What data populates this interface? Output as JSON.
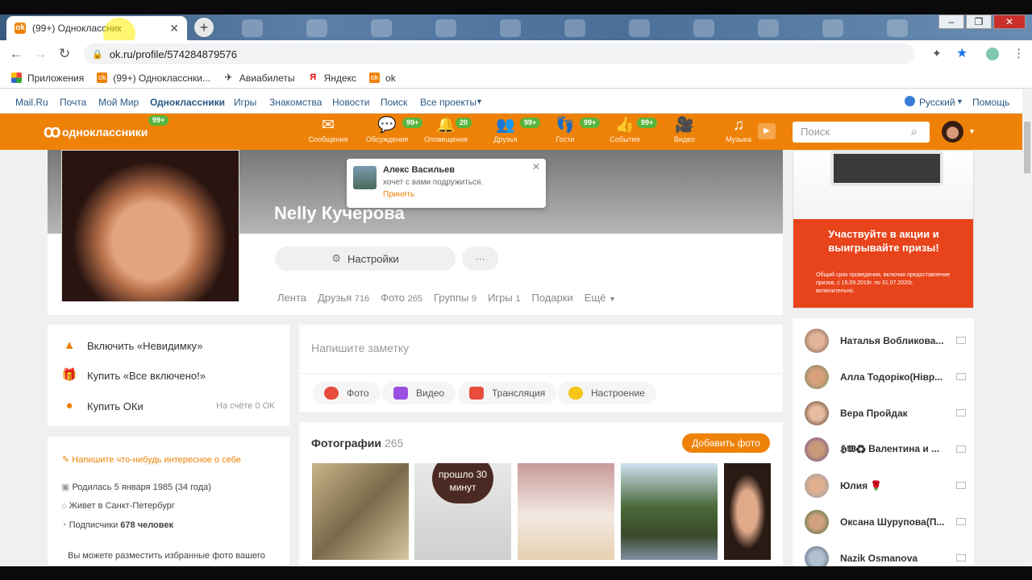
{
  "browser": {
    "tab_title": "(99+) Одноклассник",
    "tab_favicon": "ok",
    "url": "ok.ru/profile/574284879576",
    "bookmarks": [
      "Приложения",
      "(99+) Однокласснки...",
      "Авиабилеты",
      "Яндекс",
      "ok"
    ]
  },
  "portal": {
    "links": [
      "Mail.Ru",
      "Почта",
      "Мой Мир",
      "Одноклассники",
      "Игры",
      "Знакомства",
      "Новости",
      "Поиск",
      "Все проекты"
    ],
    "language": "Русский",
    "help": "Помощь"
  },
  "okbar": {
    "logo": "одноклассники",
    "logo_badge": "99+",
    "nav": [
      {
        "label": "Сообщения",
        "badge": ""
      },
      {
        "label": "Обсуждения",
        "badge": "99+"
      },
      {
        "label": "Оповещения",
        "badge": "20"
      },
      {
        "label": "Друзья",
        "badge": "99+"
      },
      {
        "label": "Гости",
        "badge": "99+"
      },
      {
        "label": "События",
        "badge": "99+"
      },
      {
        "label": "Видео",
        "badge": ""
      },
      {
        "label": "Музыка",
        "badge": ""
      }
    ],
    "search_placeholder": "Поиск",
    "accent": "#ee8208",
    "badge_color": "#58b53b"
  },
  "profile": {
    "name": "Nelly Кучерова",
    "settings": "Настройки",
    "more": "···",
    "tabs": [
      {
        "label": "Лента",
        "count": ""
      },
      {
        "label": "Друзья",
        "count": "716"
      },
      {
        "label": "Фото",
        "count": "265"
      },
      {
        "label": "Группы",
        "count": "9"
      },
      {
        "label": "Игры",
        "count": "1"
      },
      {
        "label": "Подарки",
        "count": ""
      },
      {
        "label": "Ещё",
        "count": ""
      }
    ]
  },
  "popup": {
    "name": "Алекс Васильев",
    "text": "хочет с вами подружиться.",
    "accept": "Принять"
  },
  "left_menu": {
    "invisible": "Включить «Невидимку»",
    "all_inclusive": "Купить «Все включено!»",
    "buy_ok": "Купить ОКи",
    "balance": "На счёте 0 ОК"
  },
  "about": {
    "prompt": "Напишите что-нибудь интересное о себе",
    "born": "Родилась 5 января 1985 (34 года)",
    "lives": "Живет в Санкт-Петербург",
    "followers_label": "Подписчики",
    "followers_count": "678 человек",
    "featured": "Вы можете разместить избранные фото вашего"
  },
  "composer": {
    "placeholder": "Напишите заметку",
    "actions": [
      "Фото",
      "Видео",
      "Трансляция",
      "Настроение"
    ]
  },
  "photos": {
    "title": "Фотографии",
    "count": "265",
    "add": "Добавить фото",
    "overlay": "прошло 30 минут"
  },
  "ad": {
    "headline": "Участвуйте в акции и выигрывайте призы!",
    "fine": "Общий срок проведения, включая предоставление призов, с 15.09.2019г. по 31.07.2020г. включительно."
  },
  "friends": [
    "Наталья Вобликова...",
    "Алла Тодоріко(Нівр...",
    "Вера Пройдак",
    "𝕳𝖂♻ Валентина и ...",
    "Юлия 🌹",
    "Оксана Шурупова(П...",
    "Nazik Osmanova"
  ]
}
